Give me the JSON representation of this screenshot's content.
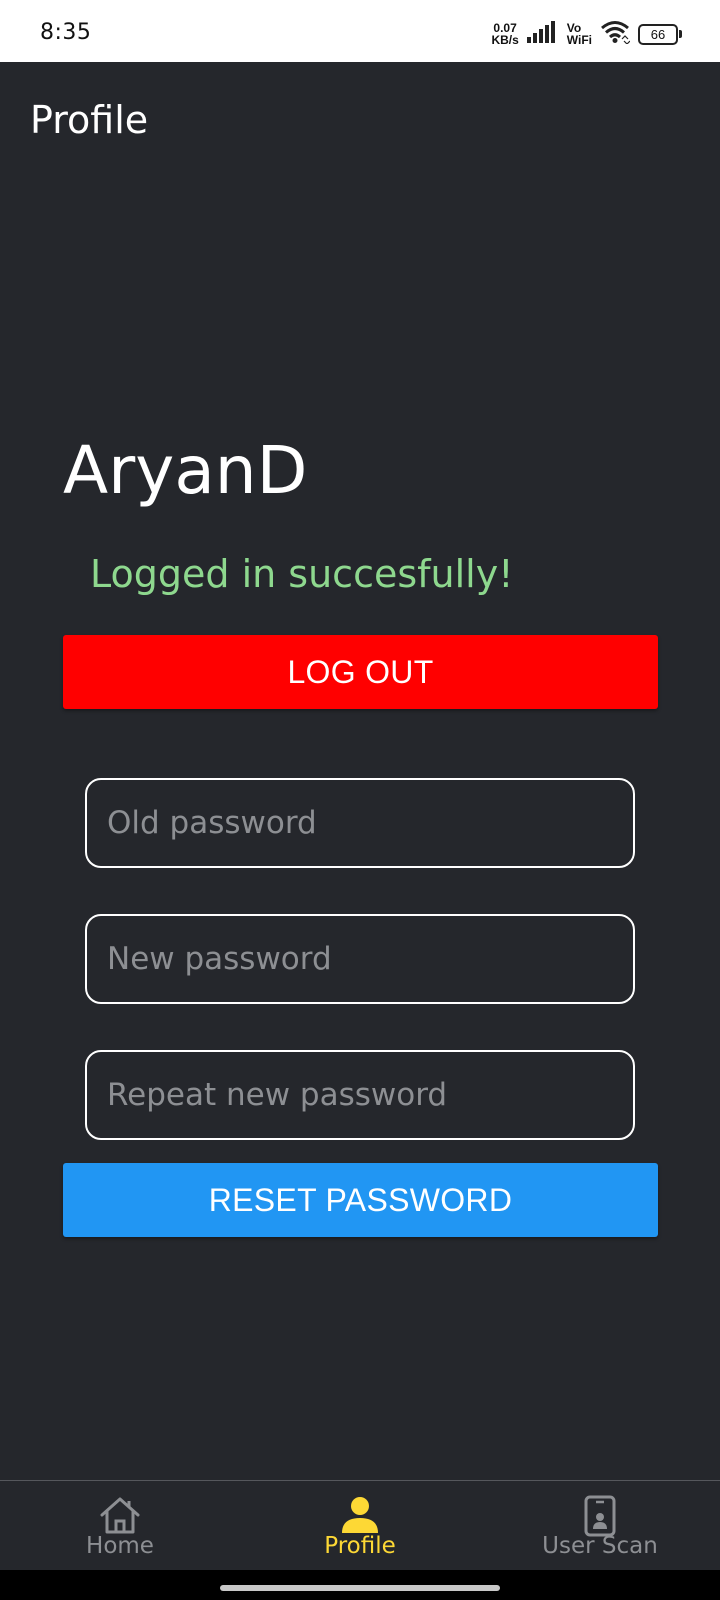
{
  "status_bar": {
    "time": "8:35",
    "net_speed_value": "0.07",
    "net_speed_unit": "KB/s",
    "vowifi_top": "Vo",
    "vowifi_bottom": "WiFi",
    "battery_level": "66"
  },
  "header": {
    "title": "Profile"
  },
  "profile": {
    "username": "AryanD",
    "status_message": "Logged in succesfully!",
    "status_color": "#8ed88e",
    "logout_label": "LOG OUT",
    "logout_color": "#ff0000"
  },
  "password_form": {
    "old_password_placeholder": "Old password",
    "old_password_value": "",
    "new_password_placeholder": "New password",
    "new_password_value": "",
    "repeat_password_placeholder": "Repeat new password",
    "repeat_password_value": "",
    "reset_label": "RESET PASSWORD",
    "reset_color": "#2196f3"
  },
  "bottom_nav": {
    "items": [
      {
        "label": "Home",
        "icon": "home-icon",
        "active": false
      },
      {
        "label": "Profile",
        "icon": "person-icon",
        "active": true
      },
      {
        "label": "User Scan",
        "icon": "phone-badge-icon",
        "active": false
      }
    ],
    "active_color": "#fdd835",
    "inactive_color": "#8d8f93"
  }
}
